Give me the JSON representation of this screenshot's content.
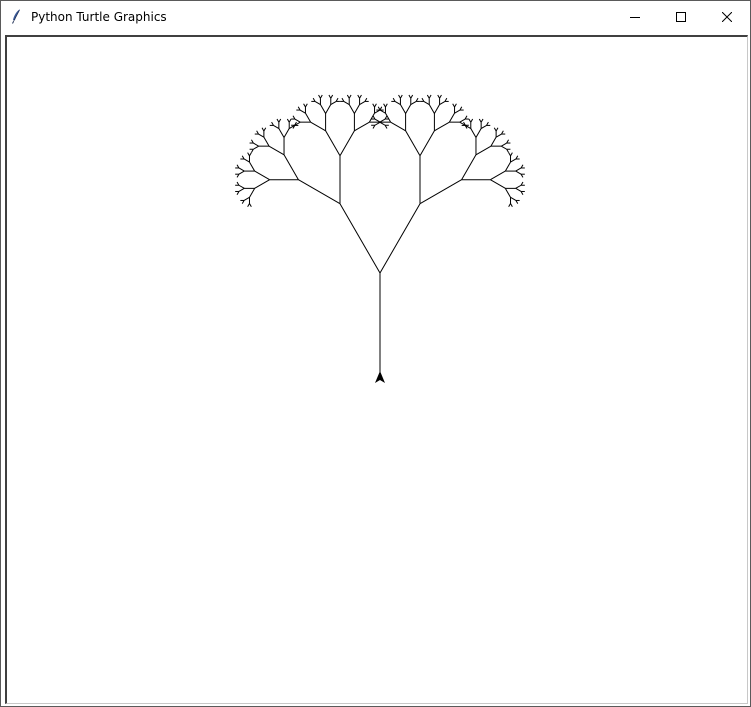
{
  "window": {
    "title": "Python Turtle Graphics",
    "icon": "feather-icon",
    "controls": [
      "minimize-icon",
      "maximize-icon",
      "close-icon"
    ]
  },
  "canvas": {
    "background": "#ffffff",
    "pen_color": "#000000",
    "drawing": "binary fractal tree",
    "turtle_heading": "up"
  }
}
